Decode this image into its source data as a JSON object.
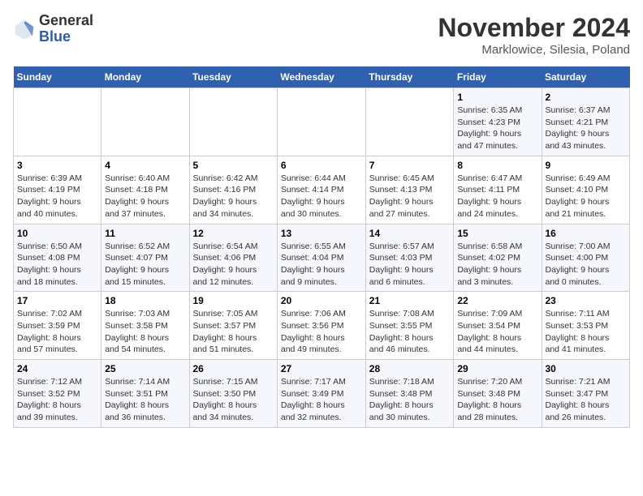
{
  "logo": {
    "general": "General",
    "blue": "Blue"
  },
  "title": "November 2024",
  "subtitle": "Marklowice, Silesia, Poland",
  "headers": [
    "Sunday",
    "Monday",
    "Tuesday",
    "Wednesday",
    "Thursday",
    "Friday",
    "Saturday"
  ],
  "weeks": [
    [
      {
        "day": "",
        "info": ""
      },
      {
        "day": "",
        "info": ""
      },
      {
        "day": "",
        "info": ""
      },
      {
        "day": "",
        "info": ""
      },
      {
        "day": "",
        "info": ""
      },
      {
        "day": "1",
        "info": "Sunrise: 6:35 AM\nSunset: 4:23 PM\nDaylight: 9 hours\nand 47 minutes."
      },
      {
        "day": "2",
        "info": "Sunrise: 6:37 AM\nSunset: 4:21 PM\nDaylight: 9 hours\nand 43 minutes."
      }
    ],
    [
      {
        "day": "3",
        "info": "Sunrise: 6:39 AM\nSunset: 4:19 PM\nDaylight: 9 hours\nand 40 minutes."
      },
      {
        "day": "4",
        "info": "Sunrise: 6:40 AM\nSunset: 4:18 PM\nDaylight: 9 hours\nand 37 minutes."
      },
      {
        "day": "5",
        "info": "Sunrise: 6:42 AM\nSunset: 4:16 PM\nDaylight: 9 hours\nand 34 minutes."
      },
      {
        "day": "6",
        "info": "Sunrise: 6:44 AM\nSunset: 4:14 PM\nDaylight: 9 hours\nand 30 minutes."
      },
      {
        "day": "7",
        "info": "Sunrise: 6:45 AM\nSunset: 4:13 PM\nDaylight: 9 hours\nand 27 minutes."
      },
      {
        "day": "8",
        "info": "Sunrise: 6:47 AM\nSunset: 4:11 PM\nDaylight: 9 hours\nand 24 minutes."
      },
      {
        "day": "9",
        "info": "Sunrise: 6:49 AM\nSunset: 4:10 PM\nDaylight: 9 hours\nand 21 minutes."
      }
    ],
    [
      {
        "day": "10",
        "info": "Sunrise: 6:50 AM\nSunset: 4:08 PM\nDaylight: 9 hours\nand 18 minutes."
      },
      {
        "day": "11",
        "info": "Sunrise: 6:52 AM\nSunset: 4:07 PM\nDaylight: 9 hours\nand 15 minutes."
      },
      {
        "day": "12",
        "info": "Sunrise: 6:54 AM\nSunset: 4:06 PM\nDaylight: 9 hours\nand 12 minutes."
      },
      {
        "day": "13",
        "info": "Sunrise: 6:55 AM\nSunset: 4:04 PM\nDaylight: 9 hours\nand 9 minutes."
      },
      {
        "day": "14",
        "info": "Sunrise: 6:57 AM\nSunset: 4:03 PM\nDaylight: 9 hours\nand 6 minutes."
      },
      {
        "day": "15",
        "info": "Sunrise: 6:58 AM\nSunset: 4:02 PM\nDaylight: 9 hours\nand 3 minutes."
      },
      {
        "day": "16",
        "info": "Sunrise: 7:00 AM\nSunset: 4:00 PM\nDaylight: 9 hours\nand 0 minutes."
      }
    ],
    [
      {
        "day": "17",
        "info": "Sunrise: 7:02 AM\nSunset: 3:59 PM\nDaylight: 8 hours\nand 57 minutes."
      },
      {
        "day": "18",
        "info": "Sunrise: 7:03 AM\nSunset: 3:58 PM\nDaylight: 8 hours\nand 54 minutes."
      },
      {
        "day": "19",
        "info": "Sunrise: 7:05 AM\nSunset: 3:57 PM\nDaylight: 8 hours\nand 51 minutes."
      },
      {
        "day": "20",
        "info": "Sunrise: 7:06 AM\nSunset: 3:56 PM\nDaylight: 8 hours\nand 49 minutes."
      },
      {
        "day": "21",
        "info": "Sunrise: 7:08 AM\nSunset: 3:55 PM\nDaylight: 8 hours\nand 46 minutes."
      },
      {
        "day": "22",
        "info": "Sunrise: 7:09 AM\nSunset: 3:54 PM\nDaylight: 8 hours\nand 44 minutes."
      },
      {
        "day": "23",
        "info": "Sunrise: 7:11 AM\nSunset: 3:53 PM\nDaylight: 8 hours\nand 41 minutes."
      }
    ],
    [
      {
        "day": "24",
        "info": "Sunrise: 7:12 AM\nSunset: 3:52 PM\nDaylight: 8 hours\nand 39 minutes."
      },
      {
        "day": "25",
        "info": "Sunrise: 7:14 AM\nSunset: 3:51 PM\nDaylight: 8 hours\nand 36 minutes."
      },
      {
        "day": "26",
        "info": "Sunrise: 7:15 AM\nSunset: 3:50 PM\nDaylight: 8 hours\nand 34 minutes."
      },
      {
        "day": "27",
        "info": "Sunrise: 7:17 AM\nSunset: 3:49 PM\nDaylight: 8 hours\nand 32 minutes."
      },
      {
        "day": "28",
        "info": "Sunrise: 7:18 AM\nSunset: 3:48 PM\nDaylight: 8 hours\nand 30 minutes."
      },
      {
        "day": "29",
        "info": "Sunrise: 7:20 AM\nSunset: 3:48 PM\nDaylight: 8 hours\nand 28 minutes."
      },
      {
        "day": "30",
        "info": "Sunrise: 7:21 AM\nSunset: 3:47 PM\nDaylight: 8 hours\nand 26 minutes."
      }
    ]
  ]
}
